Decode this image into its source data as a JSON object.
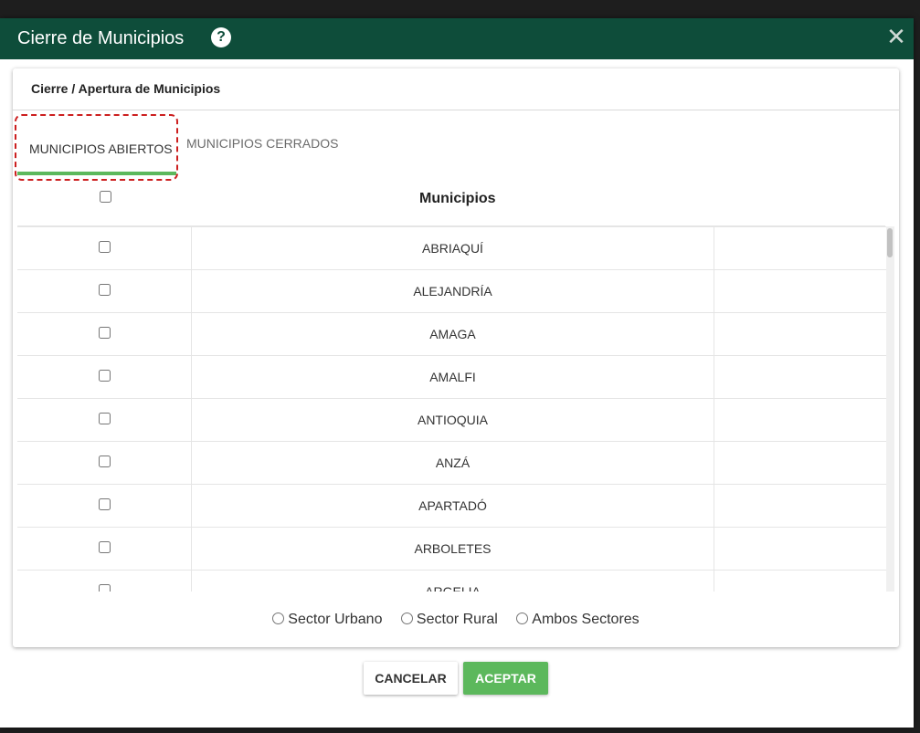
{
  "dialog": {
    "title": "Cierre de Municipios",
    "help_glyph": "?",
    "close_glyph": "✕"
  },
  "panel": {
    "title": "Cierre / Apertura de Municipios"
  },
  "tabs": [
    {
      "label": "MUNICIPIOS ABIERTOS",
      "active": true
    },
    {
      "label": "MUNICIPIOS CERRADOS",
      "active": false
    }
  ],
  "table": {
    "column_title": "Municipios",
    "rows": [
      "ABRIAQUÍ",
      "ALEJANDRÍA",
      "AMAGA",
      "AMALFI",
      "ANTIOQUIA",
      "ANZÁ",
      "APARTADÓ",
      "ARBOLETES",
      "ARGELIA"
    ]
  },
  "sectors": [
    "Sector Urbano",
    "Sector Rural",
    "Ambos Sectores"
  ],
  "buttons": {
    "cancel": "CANCELAR",
    "accept": "ACEPTAR"
  },
  "colors": {
    "titlebar": "#0e4d3a",
    "accent": "#5cb85c",
    "focus_ring": "#cc1e1e"
  }
}
